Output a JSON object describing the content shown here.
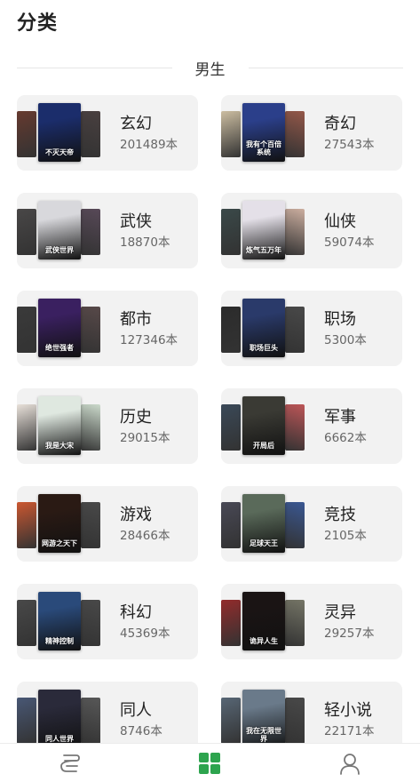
{
  "page_title": "分类",
  "section": {
    "label": "男生"
  },
  "colors": {
    "accent": "#2da44e",
    "card_bg": "#f2f2f2"
  },
  "categories": [
    {
      "name": "玄幻",
      "count": "201489本",
      "cover_text": "不灭天帝",
      "c": [
        "#5a2a1e",
        "#1b2d6b",
        "#3a3030"
      ]
    },
    {
      "name": "奇幻",
      "count": "27543本",
      "cover_text": "我有个百倍系统",
      "c": [
        "#c9b99a",
        "#2b3f8a",
        "#8c4a3a"
      ]
    },
    {
      "name": "武侠",
      "count": "18870本",
      "cover_text": "武侠世界",
      "c": [
        "#3a3838",
        "#d8d8dc",
        "#4a3a4a"
      ]
    },
    {
      "name": "仙侠",
      "count": "59074本",
      "cover_text": "炼气五万年",
      "c": [
        "#2a3a3a",
        "#e4e0e8",
        "#c8a898"
      ]
    },
    {
      "name": "都市",
      "count": "127346本",
      "cover_text": "绝世强者",
      "c": [
        "#2a2a2a",
        "#3a2060",
        "#4a3a3a"
      ]
    },
    {
      "name": "职场",
      "count": "5300本",
      "cover_text": "职场巨头",
      "c": [
        "#1a1a1a",
        "#2a3a6a",
        "#3a3a3a"
      ]
    },
    {
      "name": "历史",
      "count": "29015本",
      "cover_text": "我是大宋",
      "c": [
        "#e8e0d8",
        "#dfe8e0",
        "#c8d8c8"
      ]
    },
    {
      "name": "军事",
      "count": "6662本",
      "cover_text": "开局后",
      "c": [
        "#2a3a4a",
        "#3a3a34",
        "#b8484a"
      ]
    },
    {
      "name": "游戏",
      "count": "28466本",
      "cover_text": "网游之天下",
      "c": [
        "#c84a20",
        "#2a1a14",
        "#3a3a3a"
      ]
    },
    {
      "name": "竞技",
      "count": "2105本",
      "cover_text": "足球天王",
      "c": [
        "#3a3a48",
        "#5a6a5a",
        "#2a4a8a"
      ]
    },
    {
      "name": "科幻",
      "count": "45369本",
      "cover_text": "精神控制",
      "c": [
        "#3a3a3a",
        "#2a4a7a",
        "#3a3a3a"
      ]
    },
    {
      "name": "灵异",
      "count": "29257本",
      "cover_text": "诡异人生",
      "c": [
        "#8a1a1a",
        "#1a1414",
        "#6a6a5a"
      ]
    },
    {
      "name": "同人",
      "count": "8746本",
      "cover_text": "同人世界",
      "c": [
        "#3a4a6a",
        "#2a2a3a",
        "#4a4a4a"
      ]
    },
    {
      "name": "轻小说",
      "count": "22171本",
      "cover_text": "我在无限世界",
      "c": [
        "#4a5a6a",
        "#6a7a8a",
        "#3a3a3a"
      ]
    }
  ],
  "bottom_nav": [
    {
      "name": "bookshelf",
      "icon": "bookshelf-icon"
    },
    {
      "name": "category",
      "icon": "grid-icon",
      "active": true
    },
    {
      "name": "profile",
      "icon": "user-icon"
    }
  ]
}
